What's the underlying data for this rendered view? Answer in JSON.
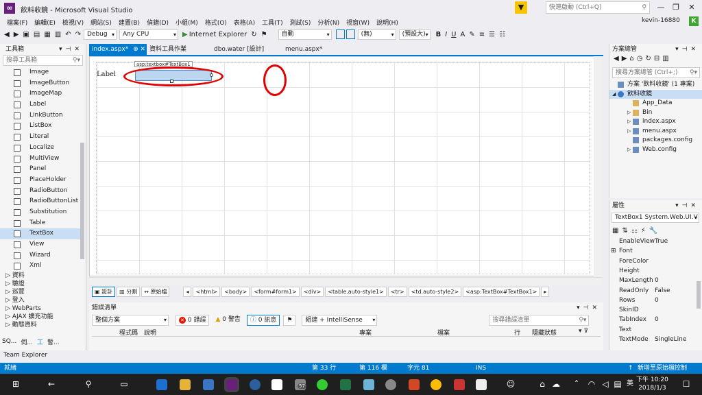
{
  "window": {
    "title": "飲料收鏡 - Microsoft Visual Studio",
    "quick_launch": "快速啟動 (Ctrl+Q)",
    "account": "kevin-16880",
    "avatar": "K",
    "filter": "▼"
  },
  "menu": [
    "檔案(F)",
    "編輯(E)",
    "檢視(V)",
    "網站(S)",
    "建置(B)",
    "偵錯(D)",
    "小組(M)",
    "格式(O)",
    "表格(A)",
    "工具(T)",
    "測試(S)",
    "分析(N)",
    "視窗(W)",
    "說明(H)"
  ],
  "toolbar": {
    "config": "Debug",
    "platform": "Any CPU",
    "run": "Internet Explorer",
    "block_format": "自動",
    "style": "(無)",
    "font_size": "(預設大)",
    "bold": "B",
    "italic": "I",
    "underline": "U"
  },
  "toolbox": {
    "title": "工具箱",
    "search": "搜尋工具箱",
    "items": [
      {
        "label": "Image",
        "icon": "image-icon"
      },
      {
        "label": "ImageButton",
        "icon": "imagebutton-icon"
      },
      {
        "label": "ImageMap",
        "icon": "imagemap-icon"
      },
      {
        "label": "Label",
        "icon": "label-icon"
      },
      {
        "label": "LinkButton",
        "icon": "linkbutton-icon"
      },
      {
        "label": "ListBox",
        "icon": "listbox-icon"
      },
      {
        "label": "Literal",
        "icon": "literal-icon"
      },
      {
        "label": "Localize",
        "icon": "localize-icon"
      },
      {
        "label": "MultiView",
        "icon": "multiview-icon"
      },
      {
        "label": "Panel",
        "icon": "panel-icon"
      },
      {
        "label": "PlaceHolder",
        "icon": "placeholder-icon"
      },
      {
        "label": "RadioButton",
        "icon": "radiobutton-icon"
      },
      {
        "label": "RadioButtonList",
        "icon": "radiobuttonlist-icon"
      },
      {
        "label": "Substitution",
        "icon": "substitution-icon"
      },
      {
        "label": "Table",
        "icon": "table-icon"
      },
      {
        "label": "TextBox",
        "icon": "textbox-icon",
        "selected": true
      },
      {
        "label": "View",
        "icon": "view-icon"
      },
      {
        "label": "Wizard",
        "icon": "wizard-icon"
      },
      {
        "label": "Xml",
        "icon": "xml-icon"
      }
    ],
    "groups": [
      "▷ 資料",
      "▷ 驗證",
      "▷ 巡覽",
      "▷ 登入",
      "▷ WebParts",
      "▷ AJAX 擴充功能",
      "▷ 動態資料"
    ],
    "bottom_tabs": [
      "SQ...",
      "伺...",
      "工",
      "暫..."
    ]
  },
  "tabs": [
    {
      "label": "index.aspx*",
      "active": true
    },
    {
      "label": "資料工具作業"
    },
    {
      "label": "dbo.water [設計]"
    },
    {
      "label": "menu.aspx*"
    }
  ],
  "designer": {
    "label_text": "Label",
    "textbox_tag": "asp:textbox#TextBox1"
  },
  "view_bar": {
    "design": "設計",
    "split": "分割",
    "source": "原始檔",
    "crumbs": [
      "<html>",
      "<body>",
      "<form#form1>",
      "<div>",
      "<table.auto-style1>",
      "<tr>",
      "<td.auto-style2>",
      "<asp:TextBox#TextBox1>"
    ]
  },
  "error_list": {
    "title": "錯誤清單",
    "scope": "整個方案",
    "errors": "0 錯誤",
    "warnings": "0 警告",
    "messages": "0 訊息",
    "build": "組建 + IntelliSense",
    "search": "搜尋錯誤清單",
    "columns": [
      "程式碼",
      "說明",
      "專案",
      "檔案",
      "行",
      "隱藏狀態"
    ]
  },
  "solution_explorer": {
    "title": "方案總管",
    "search": "搜尋方案總管 (Ctrl+;)",
    "tree": [
      {
        "label": "方案 '飲料收鏡' (1 專案)",
        "level": 0,
        "arrow": ""
      },
      {
        "label": "飲料收鏡",
        "level": 1,
        "arrow": "◢",
        "selected": true
      },
      {
        "label": "App_Data",
        "level": 2,
        "arrow": ""
      },
      {
        "label": "Bin",
        "level": 2,
        "arrow": "▷"
      },
      {
        "label": "index.aspx",
        "level": 2,
        "arrow": "▷"
      },
      {
        "label": "menu.aspx",
        "level": 2,
        "arrow": "▷"
      },
      {
        "label": "packages.config",
        "level": 2,
        "arrow": ""
      },
      {
        "label": "Web.config",
        "level": 2,
        "arrow": "▷"
      }
    ]
  },
  "properties": {
    "title": "屬性",
    "object": "TextBox1  System.Web.UI.V",
    "rows": [
      {
        "name": "EnableView",
        "value": "True"
      },
      {
        "name": "Font",
        "value": "",
        "expand": true
      },
      {
        "name": "ForeColor",
        "value": ""
      },
      {
        "name": "Height",
        "value": ""
      },
      {
        "name": "MaxLength",
        "value": "0"
      },
      {
        "name": "ReadOnly",
        "value": "False"
      },
      {
        "name": "Rows",
        "value": "0"
      },
      {
        "name": "SkinID",
        "value": ""
      },
      {
        "name": "TabIndex",
        "value": "0"
      },
      {
        "name": "Text",
        "value": ""
      },
      {
        "name": "TextMode",
        "value": "SingleLine"
      }
    ]
  },
  "team_explorer": "Team Explorer",
  "status": {
    "ready": "就緒",
    "line": "第 33 行",
    "col": "第 116 欄",
    "char": "字元 81",
    "ins": "INS",
    "publish": "新增至原始檔控制"
  },
  "taskbar": {
    "time": "下午 10:20",
    "date": "2018/1/3",
    "ime": "英",
    "badge": "57"
  }
}
